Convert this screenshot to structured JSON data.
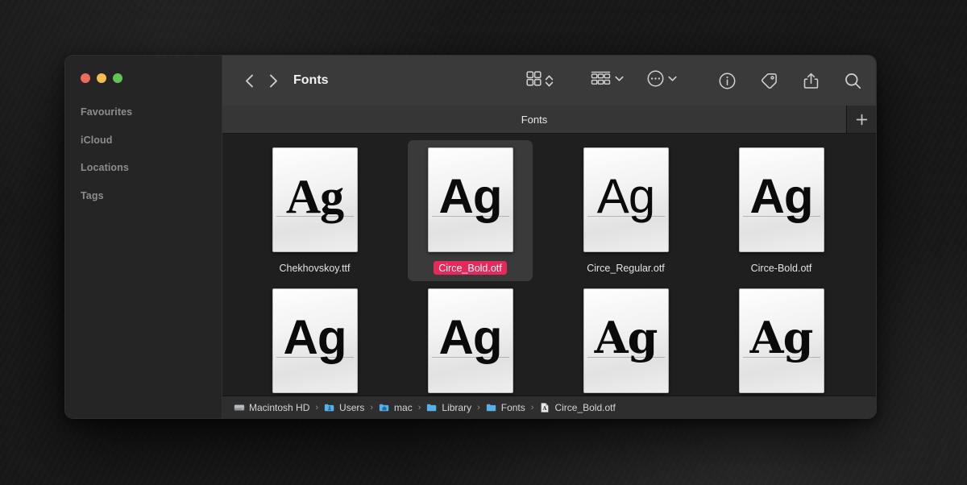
{
  "window": {
    "title": "Fonts",
    "traffic_lights": [
      {
        "name": "close",
        "color": "#ED6A5E"
      },
      {
        "name": "minimize",
        "color": "#F4BD4F"
      },
      {
        "name": "zoom",
        "color": "#61C554"
      }
    ]
  },
  "sidebar": {
    "sections": [
      {
        "label": "Favourites"
      },
      {
        "label": "iCloud"
      },
      {
        "label": "Locations"
      },
      {
        "label": "Tags"
      }
    ]
  },
  "toolbar": {
    "back_icon": "chevron-left-icon",
    "forward_icon": "chevron-right-icon",
    "view_icon": "icon-view-grid-icon",
    "view_stepper_icon": "chevron-up-down-icon",
    "group_icon": "group-by-icon",
    "group_chevron_icon": "chevron-down-icon",
    "action_icon": "ellipsis-circle-icon",
    "action_chevron_icon": "chevron-down-icon",
    "info_icon": "info-circle-icon",
    "tag_icon": "tag-icon",
    "share_icon": "share-icon",
    "search_icon": "search-icon"
  },
  "tabbar": {
    "active_tab": "Fonts",
    "new_tab_label": "+"
  },
  "files": [
    {
      "name": "Chekhovskoy.ttf",
      "preview": "Ag",
      "style": "serif",
      "selected": false
    },
    {
      "name": "Circe_Bold.otf",
      "preview": "Ag",
      "style": "sans-bold",
      "selected": true
    },
    {
      "name": "Circe_Regular.otf",
      "preview": "Ag",
      "style": "sans-reg",
      "selected": false
    },
    {
      "name": "Circe-Bold.otf",
      "preview": "Ag",
      "style": "sans-bold",
      "selected": false
    },
    {
      "name": "",
      "preview": "Ag",
      "style": "sans-bold",
      "selected": false
    },
    {
      "name": "",
      "preview": "Ag",
      "style": "sans-bold",
      "selected": false
    },
    {
      "name": "",
      "preview": "Ag",
      "style": "serif-bold",
      "selected": false
    },
    {
      "name": "",
      "preview": "Ag",
      "style": "serif-bold",
      "selected": false
    }
  ],
  "pathbar": {
    "separator": "›",
    "crumbs": [
      {
        "label": "Macintosh HD",
        "icon": "hard-drive-icon"
      },
      {
        "label": "Users",
        "icon": "users-folder-icon"
      },
      {
        "label": "mac",
        "icon": "home-folder-icon"
      },
      {
        "label": "Library",
        "icon": "folder-icon"
      },
      {
        "label": "Fonts",
        "icon": "folder-icon"
      },
      {
        "label": "Circe_Bold.otf",
        "icon": "font-file-icon"
      }
    ]
  },
  "colors": {
    "selection_badge": "#E8285A",
    "toolbar_bg": "#3a3a3a",
    "sidebar_bg": "#252525",
    "content_bg": "#1f1f1f",
    "folder_blue": "#5EB3E4"
  }
}
